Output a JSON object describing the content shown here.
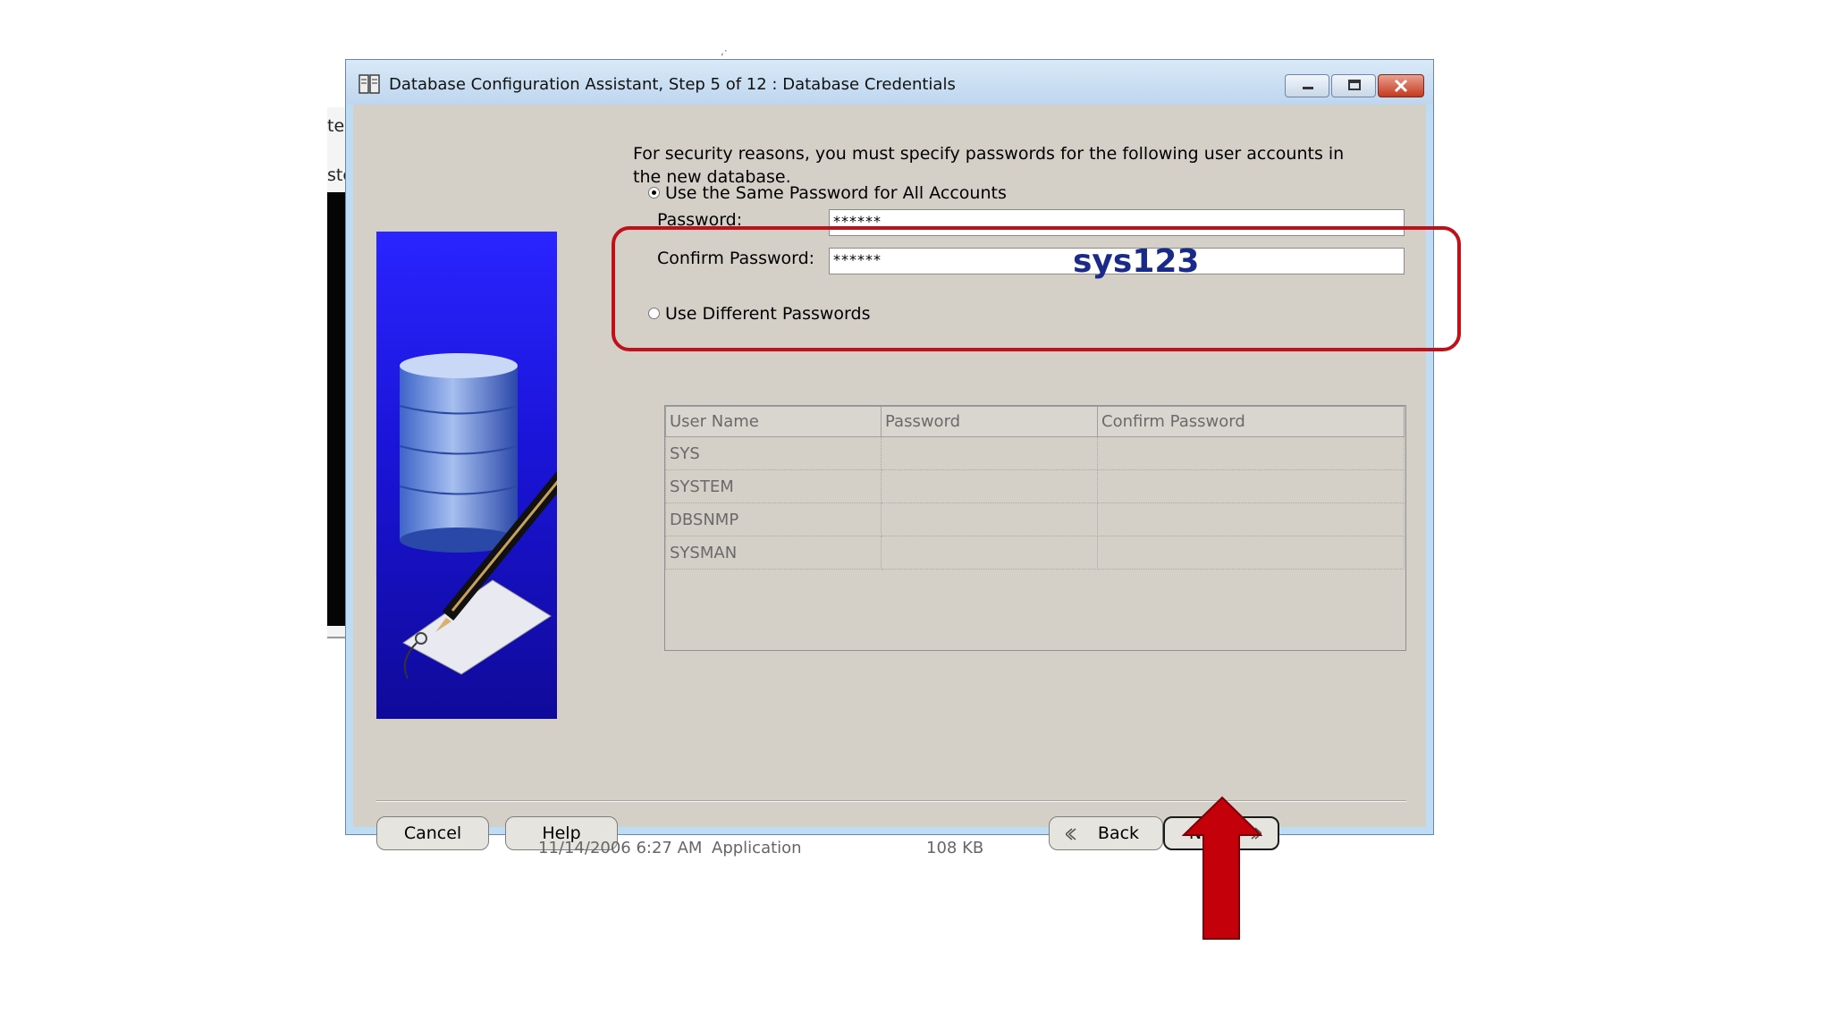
{
  "background": {
    "fragment_1": "ter",
    "fragment_2": "ste",
    "status_date": "11/14/2006 6:27 AM",
    "status_type": "Application",
    "status_size": "108 KB"
  },
  "window": {
    "title": "Database Configuration Assistant, Step 5 of 12 : Database Credentials",
    "icon": "database-app-icon"
  },
  "intro": "For security reasons, you must specify passwords for the following user accounts in the new database.",
  "options": {
    "same_password": {
      "label": "Use the Same Password for All Accounts",
      "selected": true
    },
    "different_passwords": {
      "label": "Use Different Passwords",
      "selected": false
    }
  },
  "fields": {
    "password": {
      "label": "Password:",
      "value": "******"
    },
    "confirm_password": {
      "label": "Confirm Password:",
      "value": "******"
    }
  },
  "grid": {
    "columns": [
      "User Name",
      "Password",
      "Confirm Password"
    ],
    "rows": [
      {
        "user": "SYS",
        "password": "",
        "confirm": ""
      },
      {
        "user": "SYSTEM",
        "password": "",
        "confirm": ""
      },
      {
        "user": "DBSNMP",
        "password": "",
        "confirm": ""
      },
      {
        "user": "SYSMAN",
        "password": "",
        "confirm": ""
      }
    ]
  },
  "buttons": {
    "cancel": "Cancel",
    "help": "Help",
    "back": "Back",
    "next": "Next"
  },
  "annotation": {
    "text": "sys123",
    "color": "#c0101a"
  },
  "colors": {
    "banner": "#2a24ff",
    "dialog_bg": "#d4d0c8",
    "titlebar": "#bed6ee",
    "annotation_text": "#1a2a88"
  }
}
